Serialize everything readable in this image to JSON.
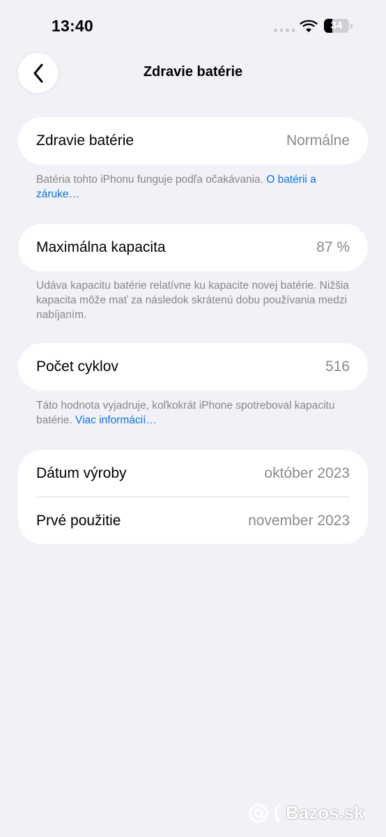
{
  "status_bar": {
    "time": "13:40",
    "battery_level": "34",
    "battery_fraction": 0.34,
    "icons": [
      "signal-dots-icon",
      "wifi-icon",
      "battery-icon"
    ]
  },
  "nav": {
    "back_icon": "chevron-left-icon",
    "title": "Zdravie batérie"
  },
  "sections": {
    "health": {
      "label": "Zdravie batérie",
      "value": "Normálne",
      "footnote_text": "Batéria tohto iPhonu funguje podľa očakávania. ",
      "footnote_link": "O batérii a záruke…"
    },
    "capacity": {
      "label": "Maximálna kapacita",
      "value": "87 %",
      "footnote_text": "Udáva kapacitu batérie relatívne ku kapacite novej batérie. Nižšia kapacita môže mať za následok skrátenú dobu používania medzi nabíjaním."
    },
    "cycles": {
      "label": "Počet cyklov",
      "value": "516",
      "footnote_text": "Táto hodnota vyjadruje, koľkokrát iPhone spotreboval kapacitu batérie. ",
      "footnote_link": "Viac informácií…"
    },
    "dates": {
      "manufactured_label": "Dátum výroby",
      "manufactured_value": "október 2023",
      "first_use_label": "Prvé použitie",
      "first_use_value": "november 2023"
    }
  },
  "watermark": {
    "text": "Bazos.sk"
  },
  "colors": {
    "background": "#f2f1f7",
    "card": "#ffffff",
    "link": "#0a74e0",
    "secondary_text": "#8a8a8e"
  }
}
